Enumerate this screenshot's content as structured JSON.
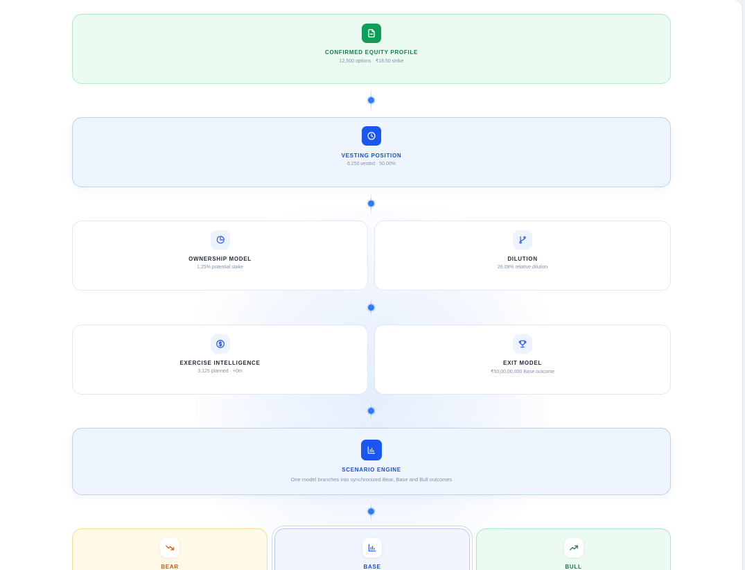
{
  "flow": {
    "profile": {
      "title": "CONFIRMED EQUITY PROFILE",
      "subtitle": "12,500 options · ₹18.50 strike",
      "icon": "document-icon"
    },
    "vesting": {
      "title": "VESTING POSITION",
      "subtitle": "6,250 vested · 50.00%",
      "icon": "clock-icon"
    },
    "ownership": {
      "title": "OWNERSHIP MODEL",
      "subtitle": "1.25% potential stake",
      "icon": "pie-chart-icon"
    },
    "dilution": {
      "title": "DILUTION",
      "subtitle": "26.09% relative dilution",
      "icon": "git-branch-icon"
    },
    "exercise": {
      "title": "EXERCISE INTELLIGENCE",
      "subtitle": "3,125 planned · +0m",
      "icon": "dollar-circle-icon"
    },
    "exit": {
      "title": "EXIT MODEL",
      "subtitle": "₹50,00,00,000 Base outcome",
      "icon": "trophy-icon"
    },
    "scenario": {
      "title": "SCENARIO ENGINE",
      "subtitle": "One model branches into synchronized Bear, Base and Bull outcomes",
      "icon": "bar-chart-icon"
    },
    "outcomes": [
      {
        "title": "BEAR",
        "icon": "trending-down-icon"
      },
      {
        "title": "BASE",
        "icon": "bar-chart-icon"
      },
      {
        "title": "BULL",
        "icon": "trending-up-icon"
      }
    ]
  },
  "colors": {
    "accent_blue": "#1a56f0",
    "accent_green": "#0f9d58",
    "bear_orange": "#cc5c10",
    "connector_dot": "#2f7bf6"
  }
}
